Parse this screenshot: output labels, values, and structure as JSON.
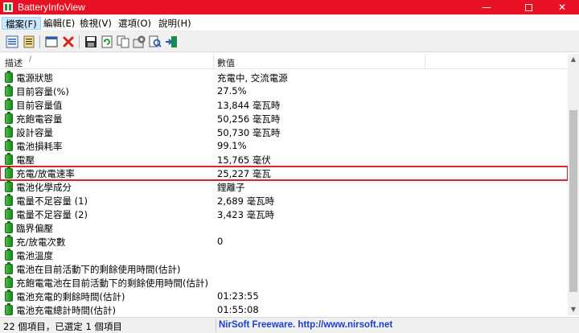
{
  "window": {
    "title": "BatteryInfoView",
    "minimize": "—",
    "close": "✕"
  },
  "menu": [
    {
      "label": "檔案(F)"
    },
    {
      "label": "編輯(E)"
    },
    {
      "label": "檢視(V)"
    },
    {
      "label": "選項(O)"
    },
    {
      "label": "說明(H)"
    }
  ],
  "toolbar_icons": [
    "properties-icon",
    "list-icon",
    "window-icon",
    "delete-icon",
    "save-icon",
    "refresh-icon",
    "copy-icon",
    "options-icon",
    "find-icon",
    "exit-icon"
  ],
  "columns": {
    "desc": "描述",
    "value": "數值"
  },
  "rows": [
    {
      "desc": "電源狀態",
      "value": "充電中, 交流電源"
    },
    {
      "desc": "目前容量(%)",
      "value": "27.5%"
    },
    {
      "desc": "目前容量值",
      "value": "13,844 毫瓦時"
    },
    {
      "desc": "充飽電容量",
      "value": "50,256 毫瓦時"
    },
    {
      "desc": "設計容量",
      "value": "50,730 毫瓦時"
    },
    {
      "desc": "電池損耗率",
      "value": "99.1%"
    },
    {
      "desc": "電壓",
      "value": "15,765 毫伏"
    },
    {
      "desc": "充電/放電速率",
      "value": "25,227 毫瓦"
    },
    {
      "desc": "電池化學成分",
      "value": "鋰離子"
    },
    {
      "desc": "電量不足容量 (1)",
      "value": "2,689 毫瓦時"
    },
    {
      "desc": "電量不足容量 (2)",
      "value": "3,423 毫瓦時"
    },
    {
      "desc": "臨界偏壓",
      "value": ""
    },
    {
      "desc": "充/放電次數",
      "value": "0"
    },
    {
      "desc": "電池溫度",
      "value": ""
    },
    {
      "desc": "電池在目前活動下的剩餘使用時間(估計)",
      "value": ""
    },
    {
      "desc": "充飽電電池在目前活動下的剩餘使用時間(估計)",
      "value": ""
    },
    {
      "desc": "電池充電的剩餘時間(估計)",
      "value": "01:23:55"
    },
    {
      "desc": "電池充電總計時間(估計)",
      "value": "01:55:08"
    }
  ],
  "selected_row": 7,
  "status": {
    "count": "22 個項目，已選定 1 個項目",
    "link": "NirSoft Freeware.  http://www.nirsoft.net"
  }
}
